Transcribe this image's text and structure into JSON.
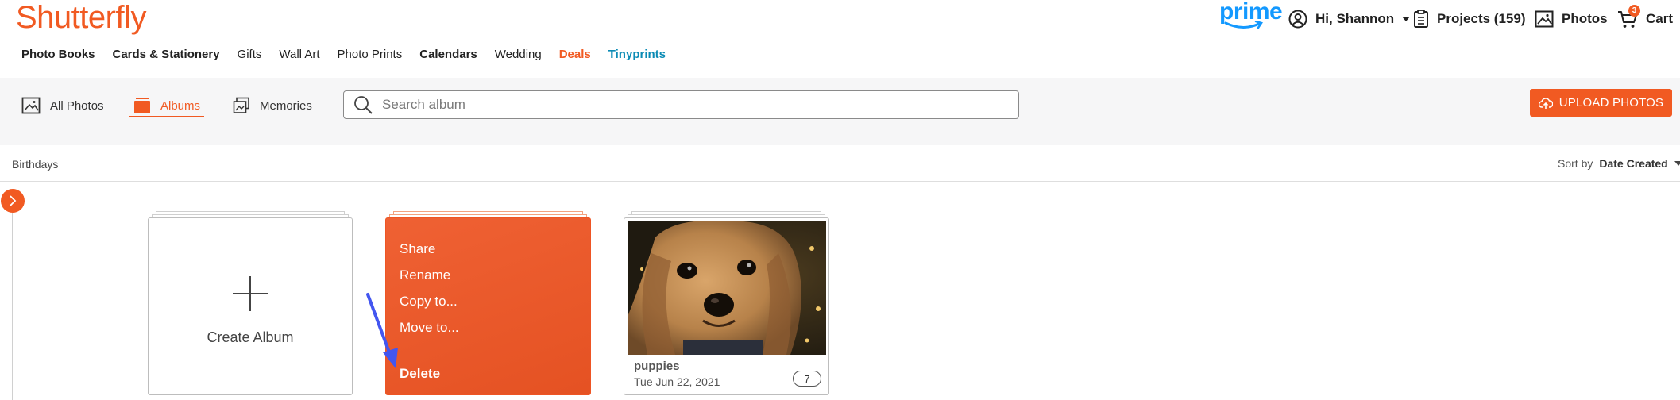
{
  "brand": {
    "logo": "Shutterfly",
    "prime": "prime"
  },
  "header": {
    "user_label": "Hi, Shannon",
    "projects_label": "Projects (159)",
    "photos_label": "Photos",
    "cart_label": "Cart",
    "cart_count": "3"
  },
  "nav": {
    "items": [
      "Photo Books",
      "Cards & Stationery",
      "Gifts",
      "Wall Art",
      "Photo Prints",
      "Calendars",
      "Wedding",
      "Deals",
      "Tinyprints"
    ]
  },
  "toolbar": {
    "tabs": [
      "All Photos",
      "Albums",
      "Memories"
    ],
    "active_tab": "Albums",
    "search_placeholder": "Search album",
    "upload_label": "UPLOAD PHOTOS"
  },
  "subheader": {
    "section_label": "Birthdays",
    "sort_prefix": "Sort by",
    "sort_value": "Date Created"
  },
  "albums": {
    "create_label": "Create Album",
    "context_menu": [
      "Share",
      "Rename",
      "Copy to...",
      "Move to...",
      "Delete"
    ],
    "items": [
      {
        "name": "puppies",
        "date": "Tue Jun 22, 2021",
        "count": "7"
      }
    ]
  },
  "colors": {
    "accent": "#f15a22",
    "prime_blue": "#1399ff",
    "tinyprints": "#0b8bb5",
    "annotation_arrow": "#4356f0"
  }
}
